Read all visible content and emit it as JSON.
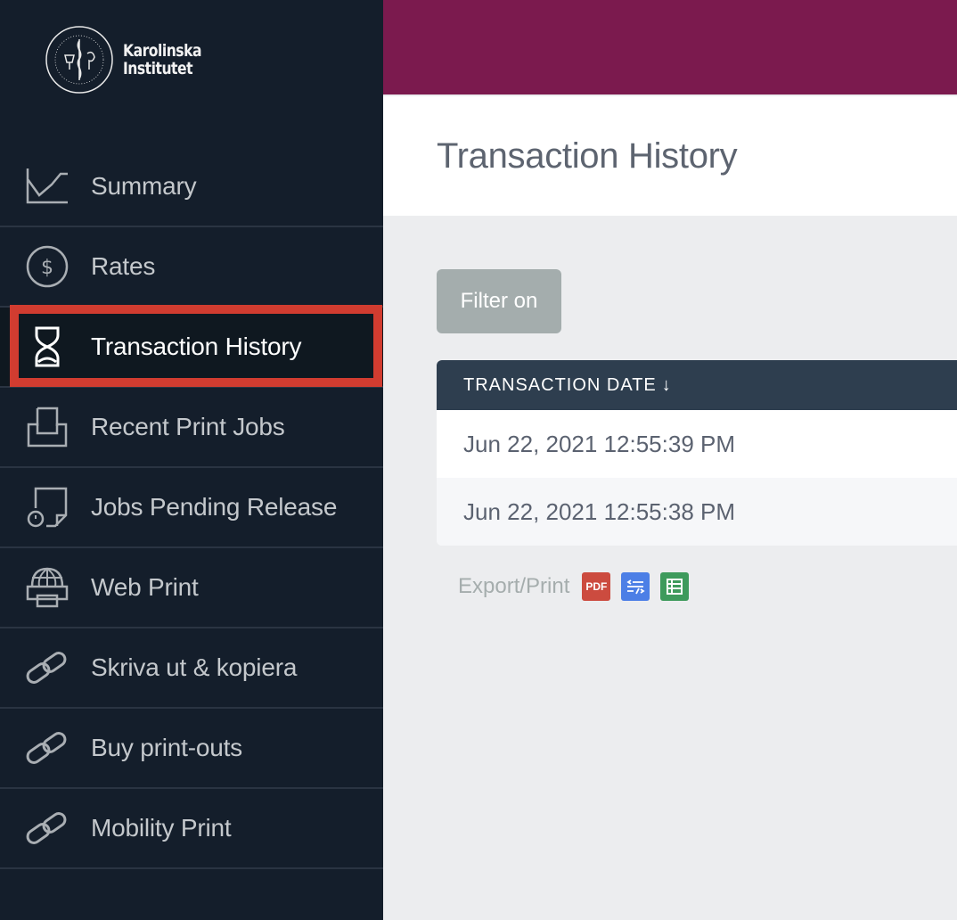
{
  "brand": {
    "name_line1": "Karolinska",
    "name_line2": "Institutet",
    "seal_text": "KAROLINSKA INSTITUTET · ANNO 1810"
  },
  "sidebar": {
    "items": [
      {
        "label": "Summary",
        "icon": "line-chart-icon",
        "active": false
      },
      {
        "label": "Rates",
        "icon": "dollar-circle-icon",
        "active": false
      },
      {
        "label": "Transaction History",
        "icon": "hourglass-icon",
        "active": true
      },
      {
        "label": "Recent Print Jobs",
        "icon": "inbox-tray-icon",
        "active": false
      },
      {
        "label": "Jobs Pending Release",
        "icon": "document-clock-icon",
        "active": false
      },
      {
        "label": "Web Print",
        "icon": "globe-printer-icon",
        "active": false
      },
      {
        "label": "Skriva ut & kopiera",
        "icon": "link-icon",
        "active": false
      },
      {
        "label": "Buy print-outs",
        "icon": "link-icon",
        "active": false
      },
      {
        "label": "Mobility Print",
        "icon": "link-icon",
        "active": false
      }
    ]
  },
  "header": {
    "title": "Transaction History"
  },
  "filter": {
    "label": "Filter on"
  },
  "table": {
    "columns": [
      {
        "label": "TRANSACTION DATE",
        "sort": "↓"
      }
    ],
    "rows": [
      {
        "transaction_date": "Jun 22, 2021 12:55:39 PM"
      },
      {
        "transaction_date": "Jun 22, 2021 12:55:38 PM"
      }
    ]
  },
  "export": {
    "label": "Export/Print",
    "pdf_label": "PDF",
    "formats": [
      "pdf",
      "xml",
      "csv"
    ]
  },
  "colors": {
    "sidebar_bg": "#141e2b",
    "topbar": "#7b1a4e",
    "highlight": "#d13c30",
    "table_header": "#2e3e4f",
    "filter_button": "#a4adad",
    "pdf": "#cc4b3f",
    "xml": "#4c7fe6",
    "csv": "#3e9a5c"
  }
}
